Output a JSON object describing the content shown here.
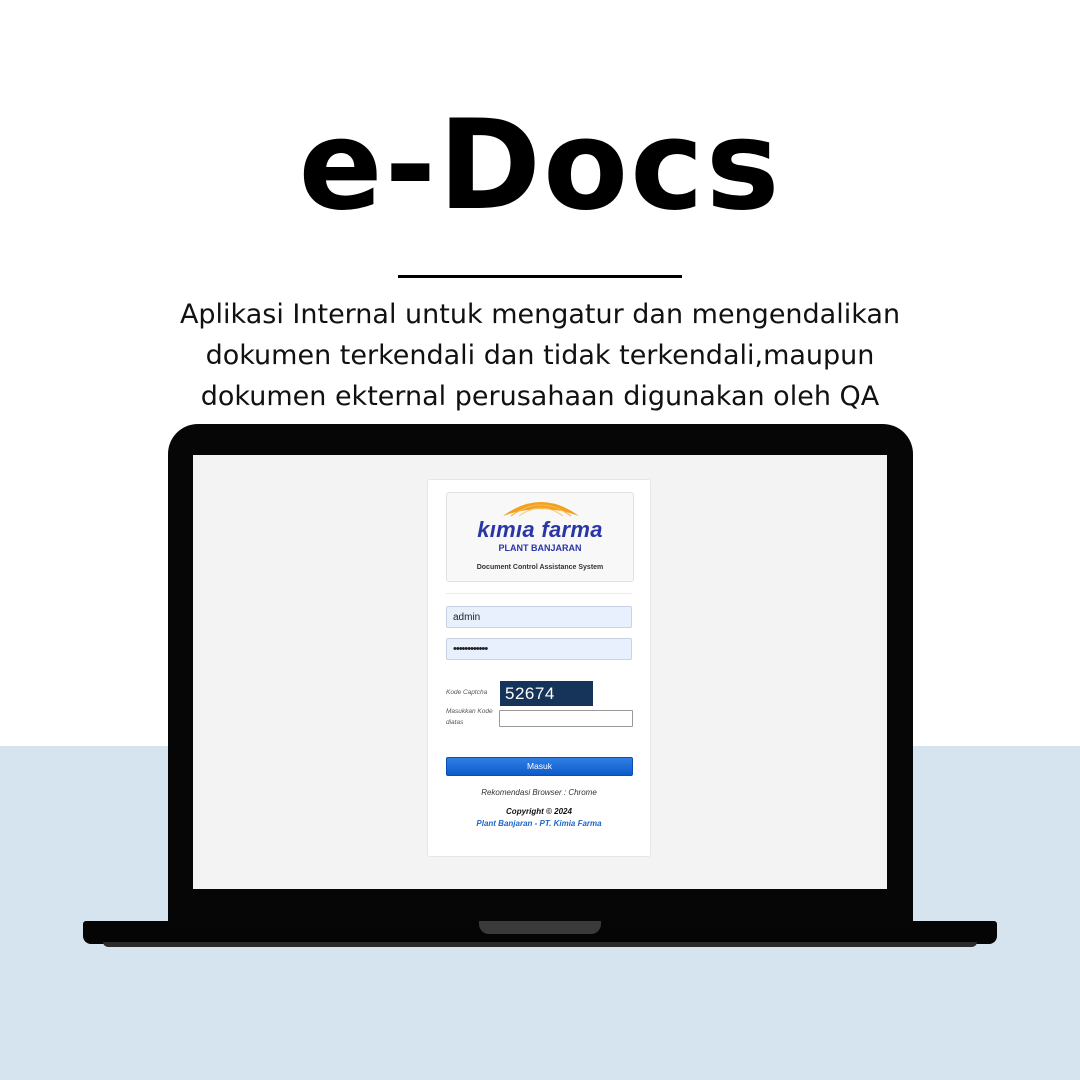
{
  "headline": "e-Docs",
  "tagline": [
    "Aplikasi Internal untuk mengatur dan mengendalikan",
    "dokumen terkendali dan tidak terkendali,maupun",
    "dokumen ekternal perusahaan digunakan oleh QA"
  ],
  "colors": {
    "background_top": "#ffffff",
    "background_bottom": "#d6e4ef",
    "brand_blue": "#2a35a8",
    "brand_orange": "#f2a01e",
    "button_blue": "#0d5bc9",
    "captcha_bg": "#16345a"
  },
  "login": {
    "logo": {
      "brand": "kımıa farma",
      "plant": "PLANT BANJARAN",
      "system": "Document Control Assistance System"
    },
    "username_value": "admin",
    "password_value": "••••••••••••",
    "captcha_label": "Kode Captcha",
    "captcha_code": "52674",
    "captcha_input_label": "Masukkan Kode diatas",
    "submit_label": "Masuk",
    "browser_recommendation": "Rekomendasi Browser : Chrome",
    "copyright": "Copyright © 2024",
    "company": "Plant Banjaran - PT. Kimia Farma"
  },
  "icons": {
    "logo_mark": "sunrise-arc-icon"
  }
}
